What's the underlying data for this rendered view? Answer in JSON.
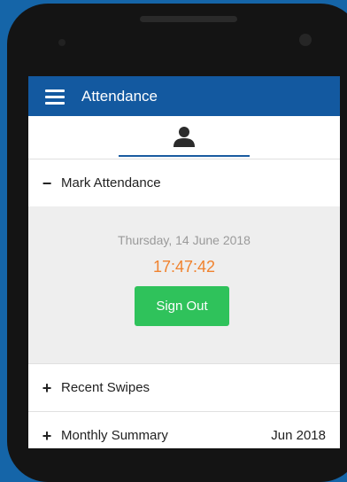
{
  "app": {
    "title": "Attendance"
  },
  "tabs": [
    {
      "icon": "person-icon"
    }
  ],
  "sections": {
    "mark": {
      "sign": "−",
      "label": "Mark Attendance"
    },
    "recent": {
      "sign": "+",
      "label": "Recent Swipes"
    },
    "monthly": {
      "sign": "+",
      "label": "Monthly Summary",
      "month": "Jun 2018"
    }
  },
  "attendance": {
    "date": "Thursday, 14 June 2018",
    "time": "17:47:42",
    "button_label": "Sign Out"
  },
  "colors": {
    "appbar": "#1359a0",
    "time": "#f0822e",
    "button": "#2fc25b",
    "background": "#1565a8"
  }
}
